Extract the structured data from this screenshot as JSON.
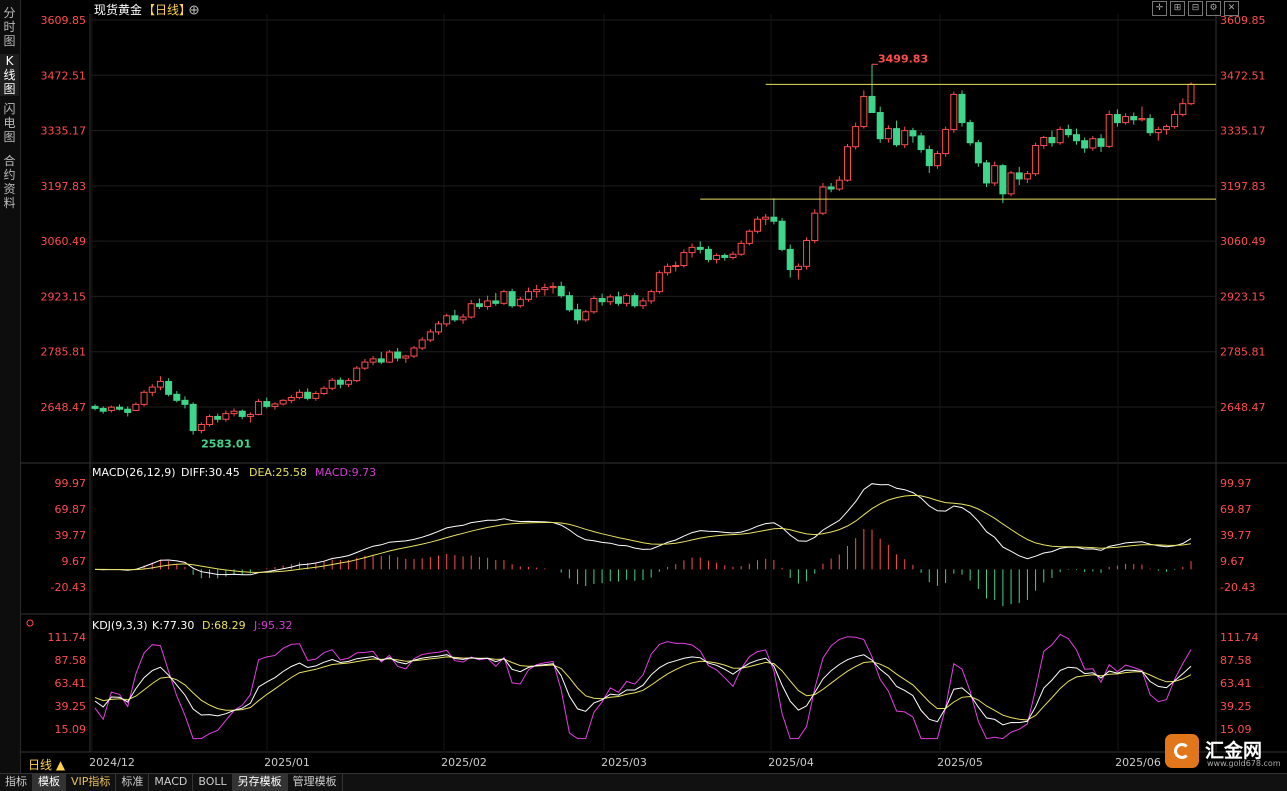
{
  "side_tabs": [
    {
      "label": "分\n时\n图",
      "active": false
    },
    {
      "label": "K\n线\n图",
      "active": true
    },
    {
      "label": "闪\n电\n图",
      "active": false
    },
    {
      "label": "合\n约\n资\n料",
      "active": false
    }
  ],
  "header": {
    "symbol": "现货黄金",
    "period_tag": "【日线】",
    "toggle_icon": "circle-plus-icon"
  },
  "toolbar_icons": [
    "crosshair-icon",
    "zoom-in-icon",
    "zoom-out-icon",
    "settings-icon",
    "close-icon"
  ],
  "price_axis": {
    "ticks": [
      "3609.85",
      "3472.51",
      "3335.17",
      "3197.83",
      "3060.49",
      "2923.15",
      "2785.81",
      "2648.47"
    ],
    "range": [
      2583.01,
      3609.85
    ]
  },
  "annotations": {
    "high": "3499.83",
    "low": "2583.01"
  },
  "macd": {
    "label": "MACD(26,12,9)",
    "diff": "DIFF:30.45",
    "dea": "DEA:25.58",
    "macd": "MACD:9.73",
    "ticks": [
      "99.97",
      "69.87",
      "39.77",
      "9.67",
      "-20.43"
    ],
    "range": [
      -20.43,
      99.97
    ]
  },
  "kdj": {
    "label": "KDJ(9,3,3)",
    "k": "K:77.30",
    "d": "D:68.29",
    "j": "J:95.32",
    "ticks": [
      "111.74",
      "87.58",
      "63.41",
      "39.25",
      "15.09"
    ],
    "range": [
      5,
      115
    ]
  },
  "date_labels": [
    "2024/12",
    "2025/01",
    "2025/02",
    "2025/03",
    "2025/04",
    "2025/05",
    "2025/06"
  ],
  "period_button": "日线 ▲",
  "bottom_tabs": [
    "指标",
    "模板",
    "VIP指标",
    "标准",
    "MACD",
    "BOLL",
    "另存模板",
    "管理模板"
  ],
  "logo": {
    "name": "汇金网",
    "url": "www.gold678.com"
  },
  "colors": {
    "up": "#ff4d4d",
    "down": "#3fd58a",
    "diff": "#ffffff",
    "dea": "#e8e060",
    "macd_label": "#d23cd2",
    "j": "#e040e0",
    "axis": "#ff4d4d"
  },
  "chart_data": {
    "type": "candlestick",
    "symbol": "现货黄金",
    "period": "日线",
    "x_range": [
      "2024-12",
      "2025-06"
    ],
    "ohlc": [
      [
        2650,
        2655,
        2640,
        2645
      ],
      [
        2645,
        2650,
        2632,
        2638
      ],
      [
        2640,
        2652,
        2635,
        2648
      ],
      [
        2648,
        2655,
        2640,
        2643
      ],
      [
        2643,
        2650,
        2625,
        2635
      ],
      [
        2640,
        2660,
        2638,
        2655
      ],
      [
        2655,
        2690,
        2650,
        2685
      ],
      [
        2685,
        2705,
        2675,
        2698
      ],
      [
        2698,
        2725,
        2690,
        2712
      ],
      [
        2712,
        2720,
        2675,
        2680
      ],
      [
        2680,
        2688,
        2660,
        2665
      ],
      [
        2665,
        2675,
        2645,
        2655
      ],
      [
        2655,
        2660,
        2580,
        2590
      ],
      [
        2590,
        2610,
        2583.01,
        2605
      ],
      [
        2605,
        2630,
        2600,
        2625
      ],
      [
        2625,
        2632,
        2610,
        2618
      ],
      [
        2618,
        2640,
        2612,
        2632
      ],
      [
        2632,
        2645,
        2625,
        2638
      ],
      [
        2638,
        2642,
        2618,
        2625
      ],
      [
        2625,
        2635,
        2610,
        2630
      ],
      [
        2630,
        2668,
        2628,
        2662
      ],
      [
        2662,
        2672,
        2645,
        2650
      ],
      [
        2650,
        2660,
        2642,
        2656
      ],
      [
        2656,
        2668,
        2652,
        2665
      ],
      [
        2665,
        2678,
        2658,
        2672
      ],
      [
        2672,
        2692,
        2668,
        2685
      ],
      [
        2685,
        2695,
        2665,
        2670
      ],
      [
        2670,
        2688,
        2664,
        2682
      ],
      [
        2682,
        2700,
        2678,
        2695
      ],
      [
        2695,
        2720,
        2690,
        2715
      ],
      [
        2715,
        2722,
        2695,
        2705
      ],
      [
        2705,
        2720,
        2698,
        2714
      ],
      [
        2714,
        2750,
        2710,
        2745
      ],
      [
        2745,
        2768,
        2740,
        2760
      ],
      [
        2760,
        2775,
        2752,
        2768
      ],
      [
        2768,
        2785,
        2755,
        2760
      ],
      [
        2760,
        2790,
        2758,
        2785
      ],
      [
        2785,
        2795,
        2762,
        2770
      ],
      [
        2770,
        2778,
        2758,
        2775
      ],
      [
        2775,
        2800,
        2770,
        2795
      ],
      [
        2795,
        2822,
        2790,
        2815
      ],
      [
        2815,
        2842,
        2810,
        2835
      ],
      [
        2835,
        2862,
        2828,
        2855
      ],
      [
        2855,
        2880,
        2848,
        2875
      ],
      [
        2875,
        2890,
        2860,
        2865
      ],
      [
        2865,
        2880,
        2855,
        2872
      ],
      [
        2872,
        2915,
        2868,
        2905
      ],
      [
        2905,
        2918,
        2892,
        2898
      ],
      [
        2898,
        2925,
        2890,
        2912
      ],
      [
        2912,
        2932,
        2900,
        2906
      ],
      [
        2906,
        2940,
        2902,
        2935
      ],
      [
        2935,
        2942,
        2895,
        2900
      ],
      [
        2900,
        2922,
        2895,
        2916
      ],
      [
        2916,
        2945,
        2910,
        2935
      ],
      [
        2935,
        2952,
        2920,
        2940
      ],
      [
        2940,
        2955,
        2925,
        2945
      ],
      [
        2945,
        2958,
        2930,
        2948
      ],
      [
        2948,
        2960,
        2920,
        2925
      ],
      [
        2925,
        2935,
        2885,
        2890
      ],
      [
        2890,
        2905,
        2855,
        2865
      ],
      [
        2865,
        2890,
        2860,
        2885
      ],
      [
        2885,
        2925,
        2880,
        2918
      ],
      [
        2918,
        2930,
        2900,
        2910
      ],
      [
        2910,
        2928,
        2902,
        2922
      ],
      [
        2922,
        2935,
        2900,
        2906
      ],
      [
        2906,
        2930,
        2898,
        2925
      ],
      [
        2925,
        2932,
        2895,
        2900
      ],
      [
        2900,
        2920,
        2892,
        2912
      ],
      [
        2912,
        2940,
        2905,
        2935
      ],
      [
        2935,
        2988,
        2930,
        2982
      ],
      [
        2982,
        3005,
        2975,
        2998
      ],
      [
        2998,
        3010,
        2985,
        3000
      ],
      [
        3000,
        3040,
        2995,
        3032
      ],
      [
        3032,
        3055,
        3020,
        3045
      ],
      [
        3045,
        3060,
        3030,
        3040
      ],
      [
        3040,
        3048,
        3008,
        3015
      ],
      [
        3015,
        3030,
        3005,
        3025
      ],
      [
        3025,
        3030,
        3012,
        3020
      ],
      [
        3020,
        3035,
        3015,
        3028
      ],
      [
        3028,
        3062,
        3024,
        3055
      ],
      [
        3055,
        3090,
        3050,
        3085
      ],
      [
        3085,
        3122,
        3080,
        3115
      ],
      [
        3115,
        3128,
        3100,
        3120
      ],
      [
        3120,
        3167,
        3102,
        3110
      ],
      [
        3110,
        3118,
        3035,
        3040
      ],
      [
        3040,
        3052,
        2970,
        2990
      ],
      [
        2990,
        3005,
        2965,
        2998
      ],
      [
        2998,
        3070,
        2990,
        3062
      ],
      [
        3062,
        3140,
        3055,
        3130
      ],
      [
        3130,
        3205,
        3125,
        3195
      ],
      [
        3195,
        3205,
        3182,
        3190
      ],
      [
        3190,
        3222,
        3185,
        3212
      ],
      [
        3212,
        3302,
        3208,
        3295
      ],
      [
        3295,
        3355,
        3288,
        3345
      ],
      [
        3345,
        3435,
        3340,
        3420
      ],
      [
        3420,
        3499.83,
        3405,
        3380
      ],
      [
        3380,
        3395,
        3305,
        3315
      ],
      [
        3315,
        3348,
        3305,
        3340
      ],
      [
        3340,
        3360,
        3295,
        3300
      ],
      [
        3300,
        3345,
        3292,
        3335
      ],
      [
        3335,
        3342,
        3305,
        3322
      ],
      [
        3322,
        3330,
        3280,
        3288
      ],
      [
        3288,
        3298,
        3230,
        3248
      ],
      [
        3248,
        3285,
        3240,
        3278
      ],
      [
        3278,
        3345,
        3270,
        3338
      ],
      [
        3338,
        3432,
        3330,
        3425
      ],
      [
        3425,
        3435,
        3345,
        3355
      ],
      [
        3355,
        3362,
        3298,
        3305
      ],
      [
        3305,
        3312,
        3245,
        3255
      ],
      [
        3255,
        3262,
        3195,
        3205
      ],
      [
        3205,
        3258,
        3198,
        3248
      ],
      [
        3248,
        3252,
        3155,
        3178
      ],
      [
        3178,
        3235,
        3172,
        3230
      ],
      [
        3230,
        3245,
        3200,
        3215
      ],
      [
        3215,
        3235,
        3205,
        3228
      ],
      [
        3228,
        3305,
        3222,
        3298
      ],
      [
        3298,
        3322,
        3290,
        3318
      ],
      [
        3318,
        3335,
        3295,
        3305
      ],
      [
        3305,
        3345,
        3300,
        3338
      ],
      [
        3338,
        3350,
        3318,
        3325
      ],
      [
        3325,
        3340,
        3300,
        3310
      ],
      [
        3310,
        3318,
        3280,
        3292
      ],
      [
        3292,
        3322,
        3285,
        3315
      ],
      [
        3315,
        3326,
        3282,
        3296
      ],
      [
        3296,
        3385,
        3292,
        3375
      ],
      [
        3375,
        3388,
        3345,
        3355
      ],
      [
        3355,
        3378,
        3350,
        3370
      ],
      [
        3370,
        3380,
        3350,
        3362
      ],
      [
        3362,
        3395,
        3358,
        3365
      ],
      [
        3365,
        3376,
        3322,
        3330
      ],
      [
        3330,
        3345,
        3310,
        3338
      ],
      [
        3338,
        3350,
        3325,
        3345
      ],
      [
        3345,
        3385,
        3340,
        3375
      ],
      [
        3375,
        3415,
        3370,
        3402
      ],
      [
        3402,
        3455,
        3398,
        3450
      ]
    ],
    "resistance": 3450,
    "support": 3165,
    "high_point": 3499.83,
    "low_point": 2583.01
  }
}
